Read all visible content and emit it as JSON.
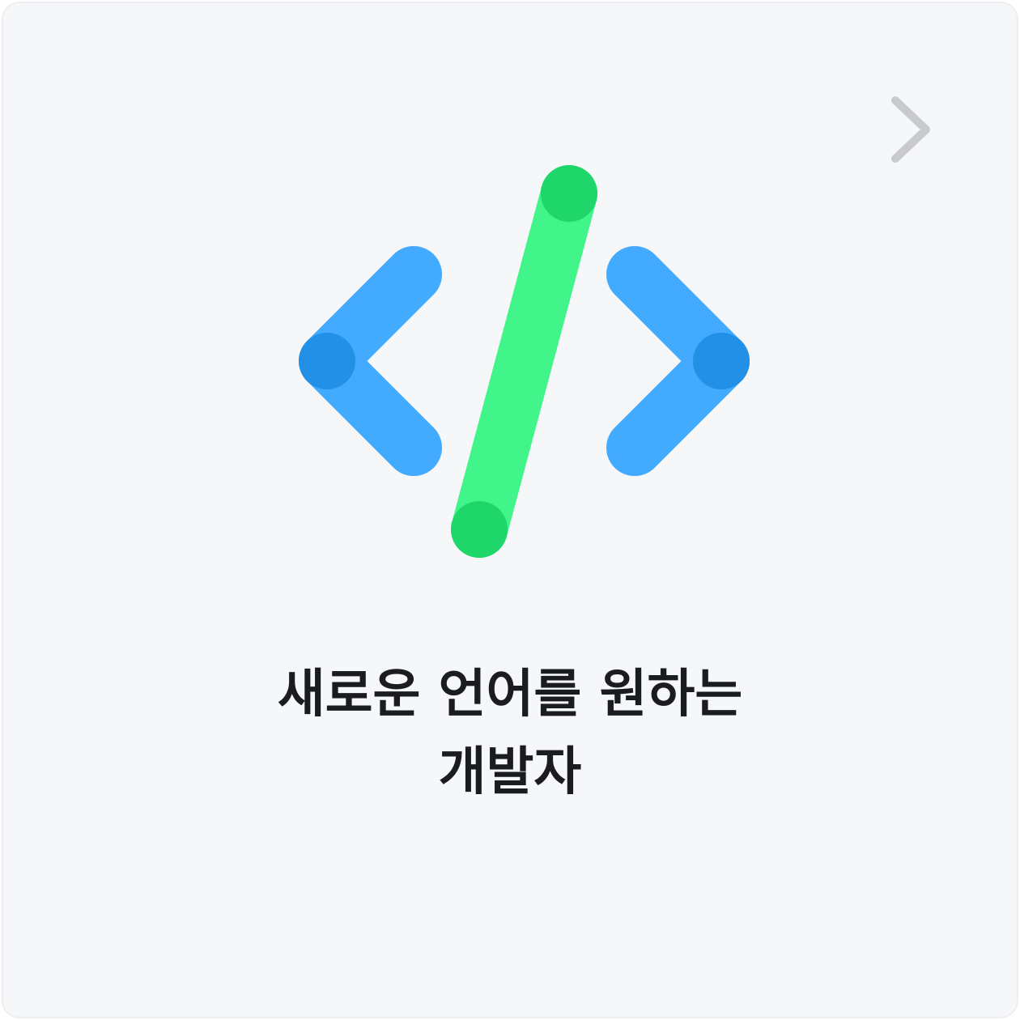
{
  "card": {
    "title_line1": "새로운 언어를 원하는",
    "title_line2": "개발자",
    "icon": "code-brackets-icon",
    "nav_icon": "chevron-right-icon"
  },
  "colors": {
    "background": "#f6f7f9",
    "bracket_blue": "#42aaff",
    "bracket_blue_dark": "#2290e6",
    "slash_green": "#42f58a",
    "slash_green_dark": "#1fd66a",
    "chevron_gray": "#c8cacd",
    "text": "#1b1c1e"
  }
}
